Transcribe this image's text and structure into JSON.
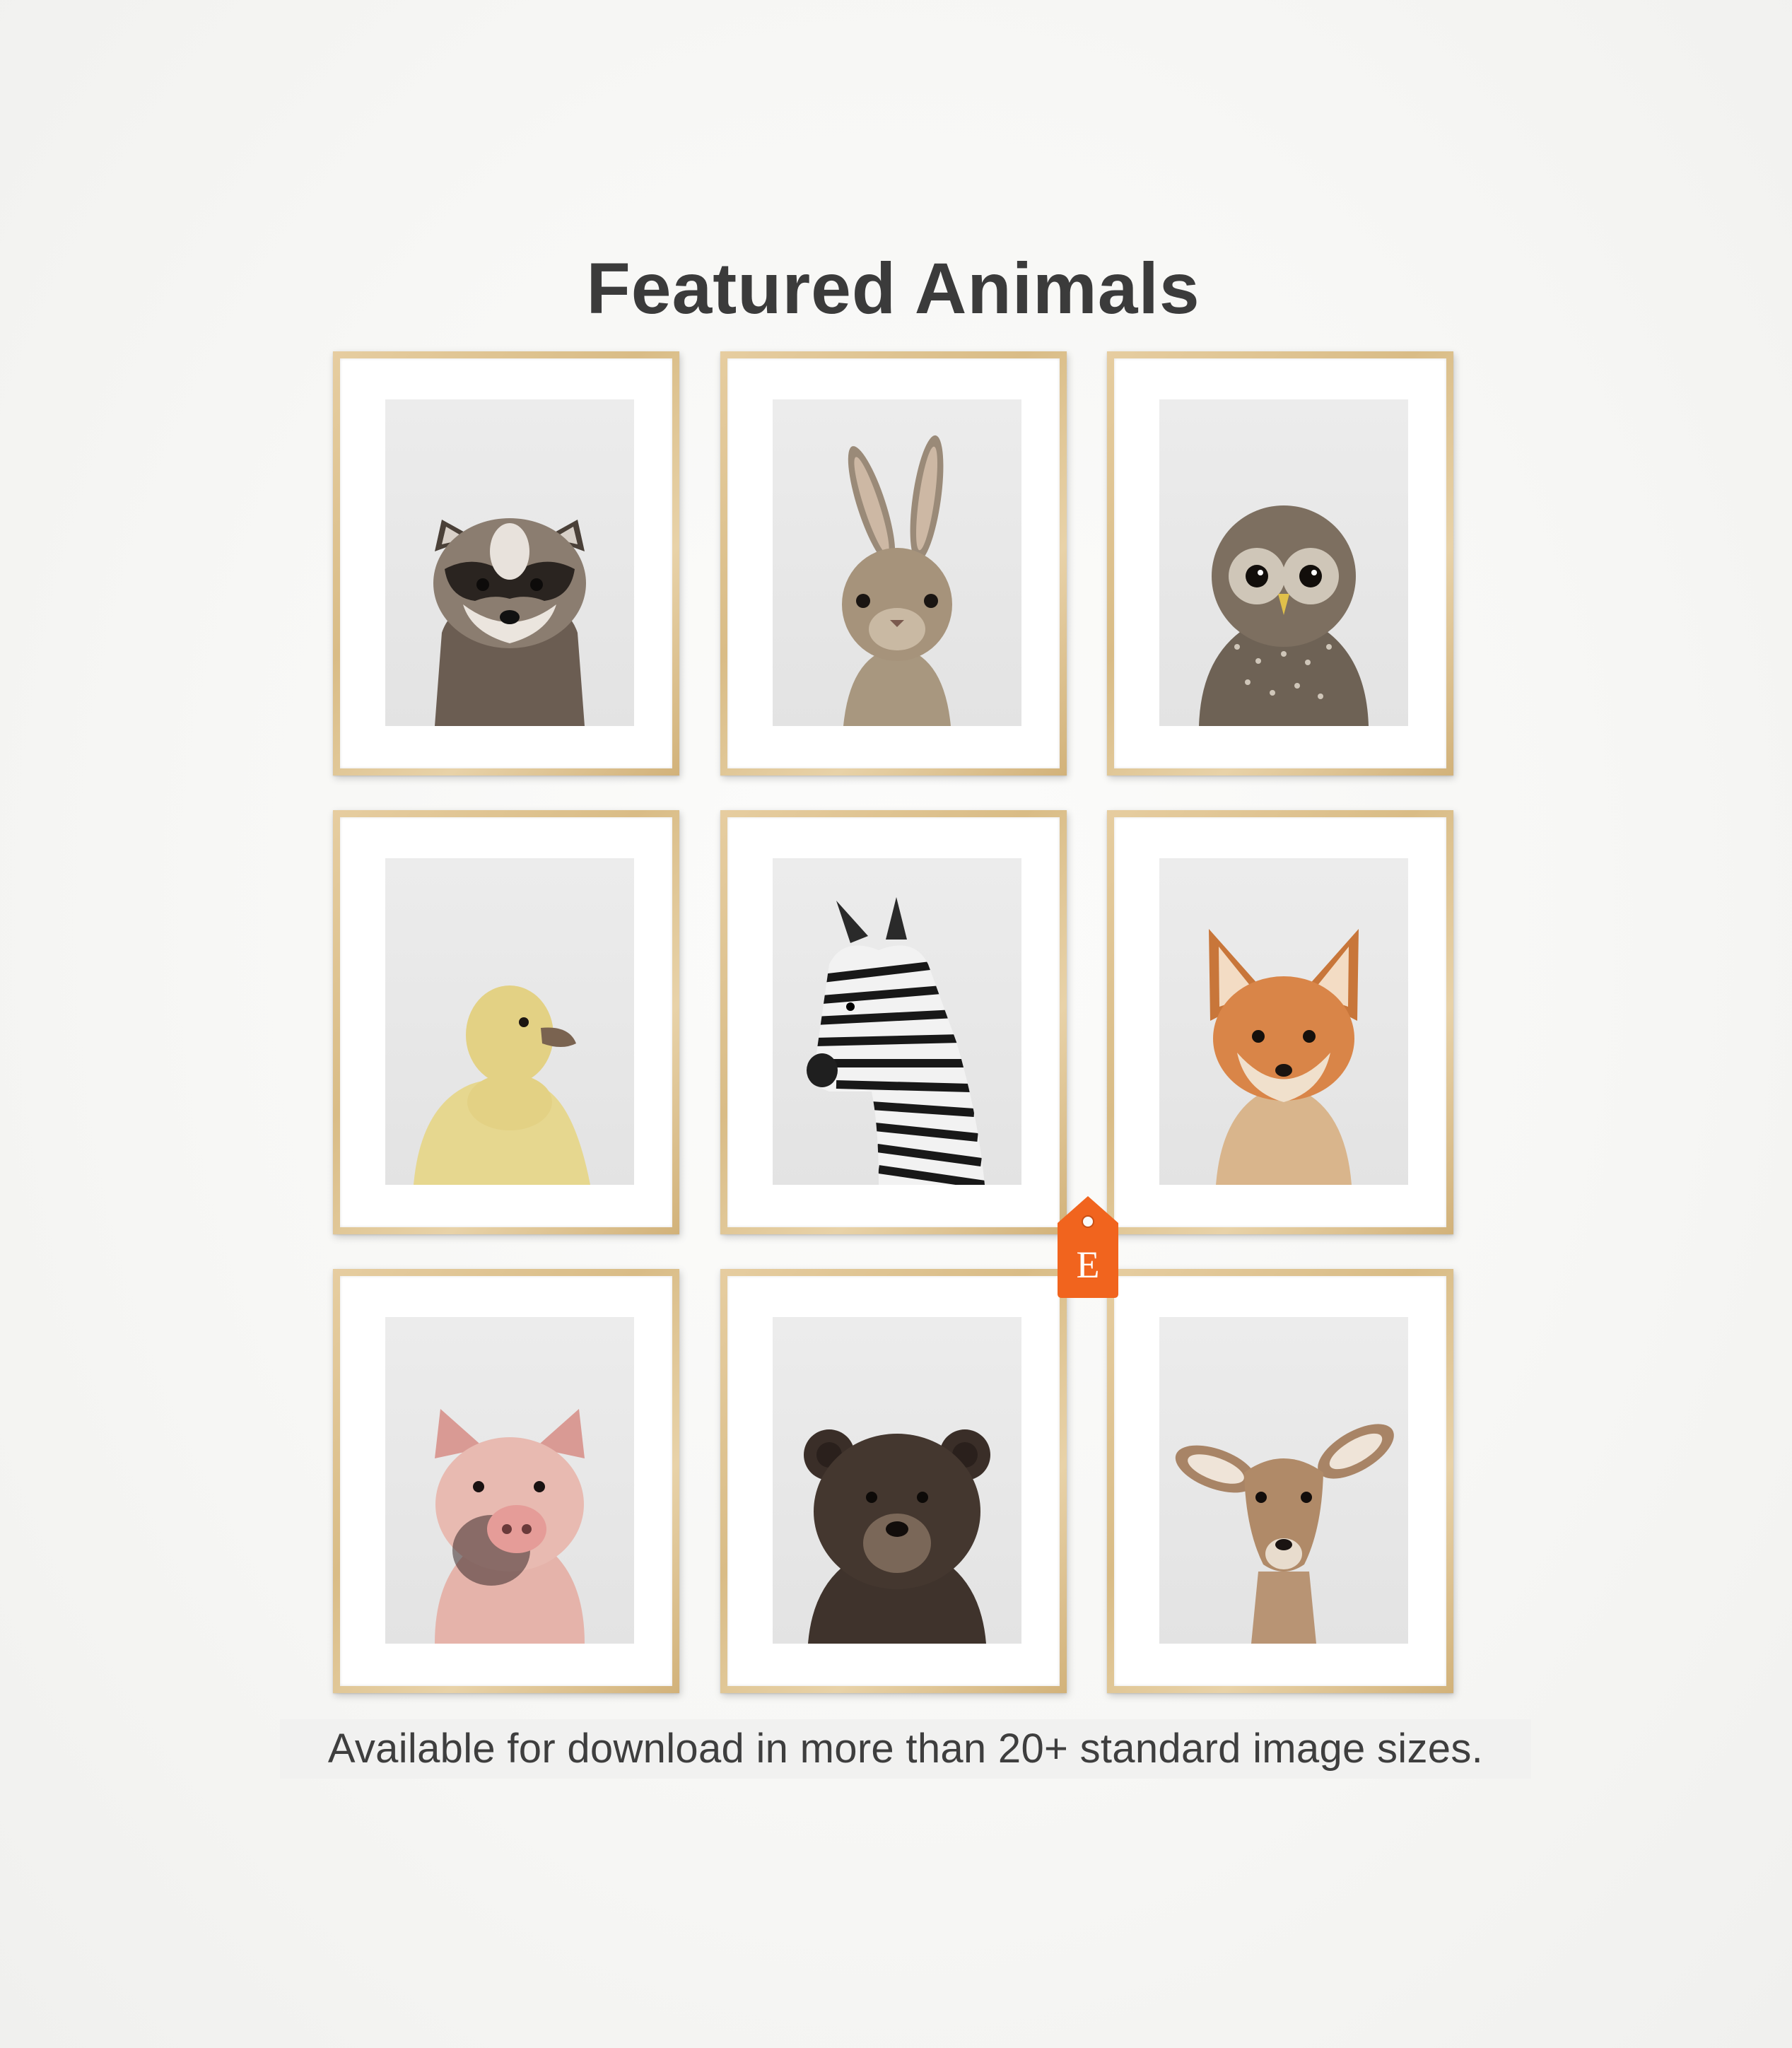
{
  "title": "Featured Animals",
  "caption": "Available for download in more than 20+ standard image sizes.",
  "badge": {
    "letter": "E",
    "color": "#f1641e"
  },
  "prints": [
    {
      "animal": "raccoon"
    },
    {
      "animal": "bunny"
    },
    {
      "animal": "owl"
    },
    {
      "animal": "duckling"
    },
    {
      "animal": "zebra"
    },
    {
      "animal": "fox"
    },
    {
      "animal": "pig"
    },
    {
      "animal": "bear"
    },
    {
      "animal": "deer"
    }
  ]
}
